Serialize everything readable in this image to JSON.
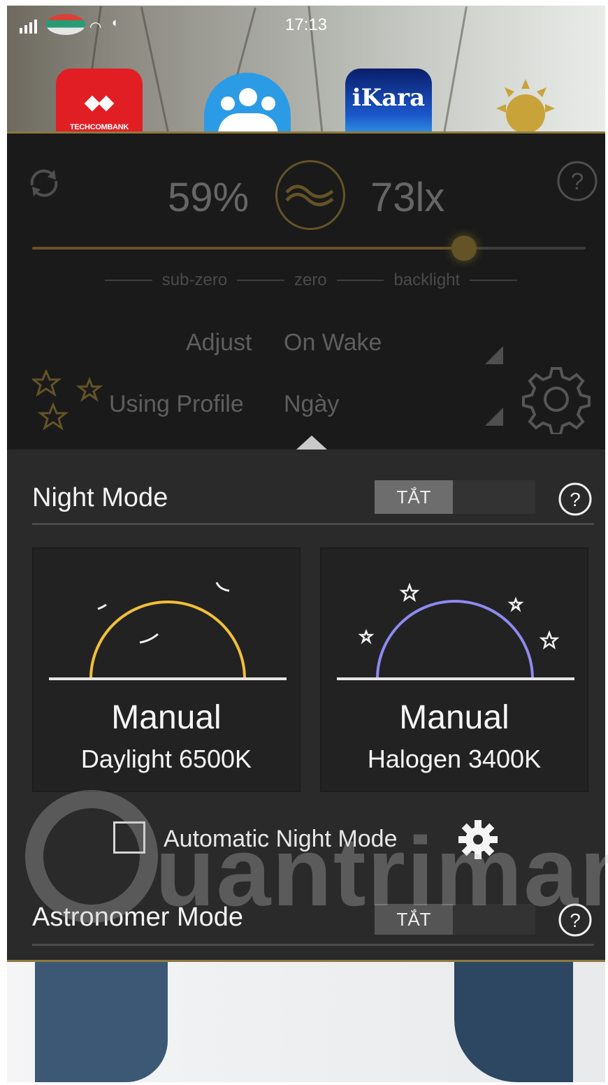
{
  "status_bar": {
    "time": "17:13",
    "icons": [
      "signal-icon",
      "carrier-logo",
      "wifi-icon",
      "mute-icon"
    ]
  },
  "home_apps": [
    {
      "name": "Techcombank",
      "label": "TECHCOMBANK",
      "color": "#e21e25"
    },
    {
      "name": "group-app",
      "label": "",
      "color": "#2c9be6"
    },
    {
      "name": "iKara",
      "label": "iKara",
      "color": "#1a57c9"
    },
    {
      "name": "lux-app",
      "label": "",
      "color": "#c8a33a"
    }
  ],
  "lux_panel": {
    "brightness": "59%",
    "lux": "73lx",
    "slider": {
      "value": 0.78,
      "labels": [
        "sub-zero",
        "zero",
        "backlight"
      ]
    },
    "adjust": {
      "label": "Adjust",
      "value": "On Wake"
    },
    "profile": {
      "label": "Using Profile",
      "value": "Ngày"
    },
    "accent_color": "#c8a33a"
  },
  "night_mode": {
    "title": "Night Mode",
    "toggle_label": "TẮT",
    "cards": [
      {
        "mode": "Manual",
        "temperature": "Daylight 6500K",
        "arc_color": "#f2bf3a",
        "icon": "sun-horizon-icon"
      },
      {
        "mode": "Manual",
        "temperature": "Halogen 3400K",
        "arc_color": "#8f8af0",
        "icon": "moon-horizon-icon"
      }
    ],
    "automatic": {
      "label": "Automatic Night Mode",
      "checked": false
    }
  },
  "astronomer_mode": {
    "title": "Astronomer Mode",
    "toggle_label": "TẮT"
  },
  "watermark": {
    "text": "uantrimang"
  }
}
